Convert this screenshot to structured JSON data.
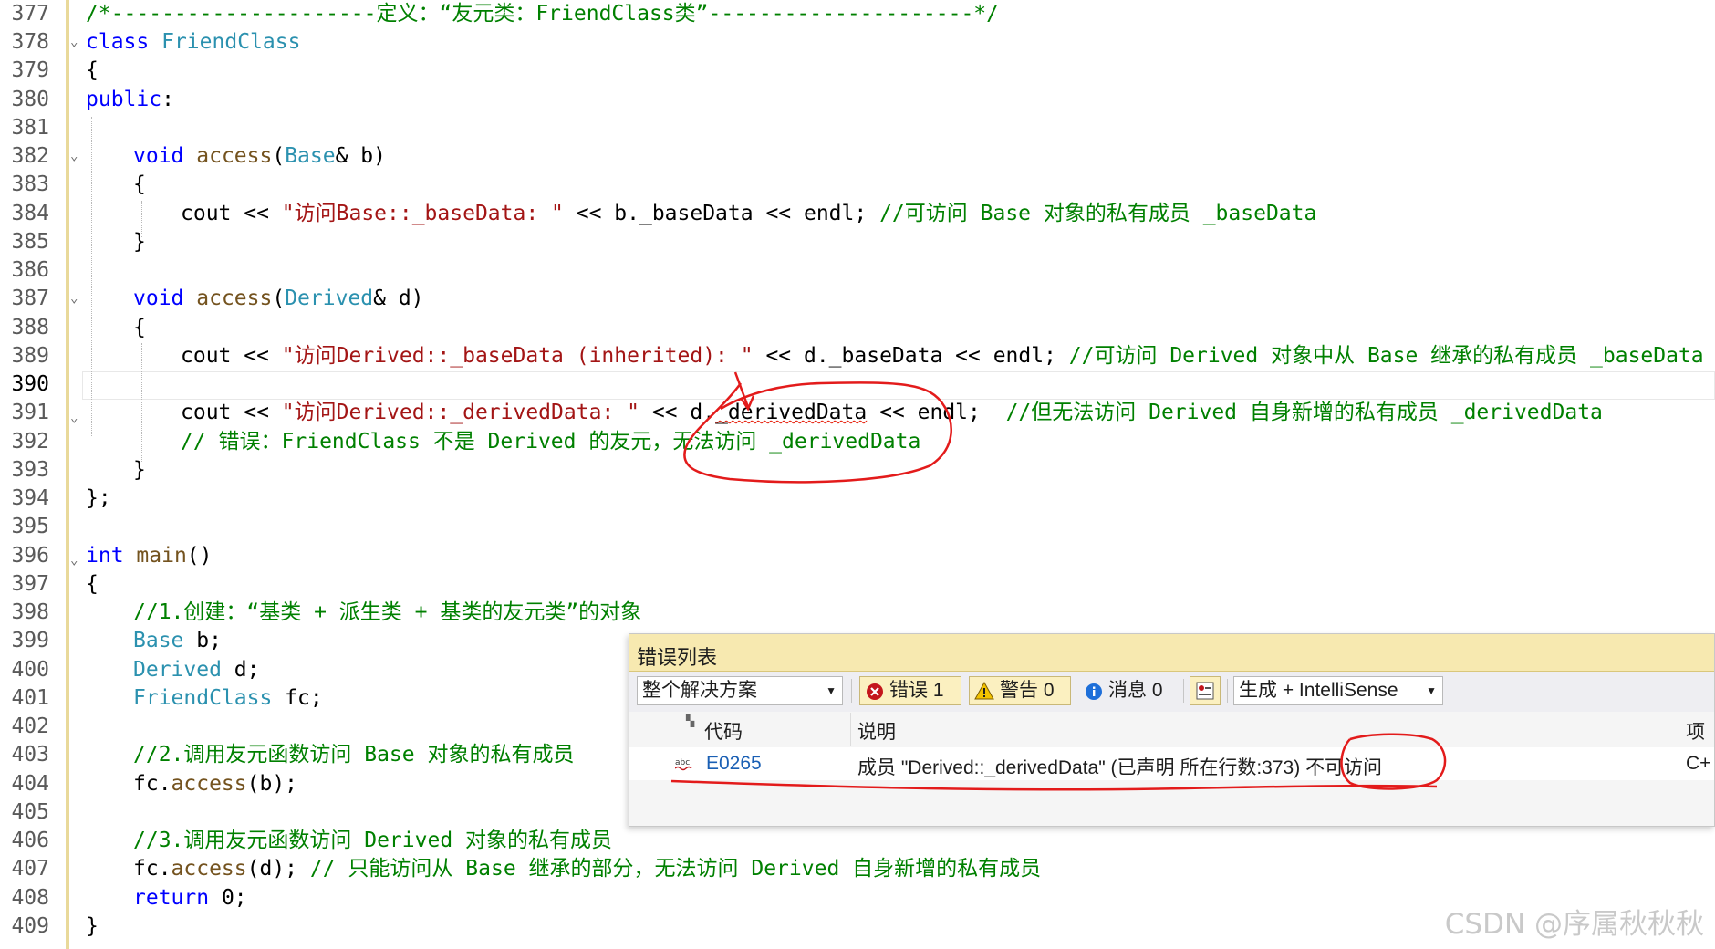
{
  "editor": {
    "line_numbers": [
      "377",
      "378",
      "379",
      "380",
      "381",
      "382",
      "383",
      "384",
      "385",
      "386",
      "387",
      "388",
      "389",
      "390",
      "391",
      "392",
      "393",
      "394",
      "395",
      "396",
      "397",
      "398",
      "399",
      "400",
      "401",
      "402",
      "403",
      "404",
      "405",
      "406",
      "407",
      "408",
      "409"
    ],
    "current_line": "390",
    "lines": {
      "l377": "/*---------------------定义：“友元类：FriendClass类”---------------------*/",
      "l378_kw": "class",
      "l378_name": "FriendClass",
      "l379": "{",
      "l380_kw": "public",
      "l380_colon": ":",
      "l382_kw": "void",
      "l382_fn": "access",
      "l382_open": "(",
      "l382_type": "Base",
      "l382_rest": "& b)",
      "l383": "{",
      "l384_a": "cout << ",
      "l384_str": "\"访问Base::_baseData: \"",
      "l384_b": " << b._baseData << endl; ",
      "l384_cm": "//可访问 Base 对象的私有成员 _baseData",
      "l385": "}",
      "l387_kw": "void",
      "l387_fn": "access",
      "l387_open": "(",
      "l387_type": "Derived",
      "l387_rest": "& d)",
      "l388": "{",
      "l389_a": "cout << ",
      "l389_str": "\"访问Derived::_baseData (inherited): \"",
      "l389_b": " << d._baseData << endl; ",
      "l389_cm": "//可访问 Derived 对象中从 Base 继承的私有成员 _baseData",
      "l391_a": "cout << ",
      "l391_str": "\"访问Derived::_derivedData: \"",
      "l391_b": " << d.",
      "l391_err": "_derivedData",
      "l391_c": " << endl;  ",
      "l391_cm": "//但无法访问 Derived 自身新增的私有成员 _derivedData",
      "l392_cm": "// 错误：FriendClass 不是 Derived 的友元，无法访问 _derivedData",
      "l393": "}",
      "l394": "};",
      "l396_kw": "int",
      "l396_fn": "main",
      "l396_rest": "()",
      "l397": "{",
      "l398_cm": "//1.创建：“基类 + 派生类 + 基类的友元类”的对象",
      "l399_type": "Base",
      "l399_rest": " b;",
      "l400_type": "Derived",
      "l400_rest": " d;",
      "l401_type": "FriendClass",
      "l401_rest": " fc;",
      "l403_cm": "//2.调用友元函数访问 Base 对象的私有成员",
      "l404_a": "fc.",
      "l404_fn": "access",
      "l404_rest": "(b);",
      "l406_cm": "//3.调用友元函数访问 Derived 对象的私有成员",
      "l407_a": "fc.",
      "l407_fn": "access",
      "l407_rest": "(d); ",
      "l407_cm": "// 只能访问从 Base 继承的部分，无法访问 Derived 自身新增的私有成员",
      "l408_kw": "return",
      "l408_rest": " 0;",
      "l409": "}"
    }
  },
  "error_list": {
    "title": "错误列表",
    "scope_dropdown": "整个解决方案",
    "errors_button": "错误 1",
    "warnings_button": "警告 0",
    "messages_button": "消息 0",
    "source_dropdown": "生成 + IntelliSense",
    "columns": {
      "code": "代码",
      "description": "说明",
      "project": "项目"
    },
    "rows": [
      {
        "code": "E0265",
        "description": "成员 \"Derived::_derivedData\" (已声明 所在行数:373)",
        "description_tail": "不可访问",
        "project": "C+"
      }
    ]
  },
  "watermark": "CSDN @序属秋秋秋",
  "colors": {
    "annotation": "#e31b1b",
    "error_icon": "#c4161c",
    "warning_icon": "#f2c200",
    "info_icon": "#1e6fd9",
    "title_bar": "#f7e9b0"
  }
}
